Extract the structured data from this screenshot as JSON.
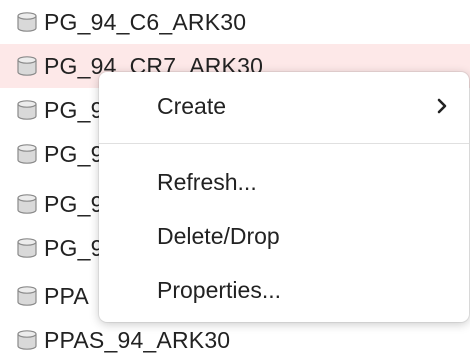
{
  "tree": {
    "items": [
      {
        "label": "PG_94_C6_ARK30",
        "icon": "database-icon"
      },
      {
        "label": "PG_94_CR7_ARK30",
        "icon": "database-icon",
        "selected": true
      },
      {
        "label": "PG_9",
        "icon": "database-icon"
      },
      {
        "label": "PG_9",
        "icon": "database-icon"
      },
      {
        "label": "PG_9",
        "icon": "database-icon"
      },
      {
        "label": "PG_9",
        "icon": "database-icon"
      },
      {
        "label": "PPA",
        "icon": "database-icon"
      },
      {
        "label": "PPAS_94_ARK30",
        "icon": "database-icon"
      }
    ]
  },
  "context_menu": {
    "items": [
      {
        "label": "Create",
        "has_submenu": true,
        "submenu_icon": "chevron-right-icon"
      },
      {
        "label": "Refresh..."
      },
      {
        "label": "Delete/Drop"
      },
      {
        "label": "Properties..."
      }
    ]
  },
  "colors": {
    "selected_row": "#fde8e8",
    "text": "#222222",
    "icon_fill": "#d9d9d9",
    "icon_stroke": "#8a8a8a"
  }
}
